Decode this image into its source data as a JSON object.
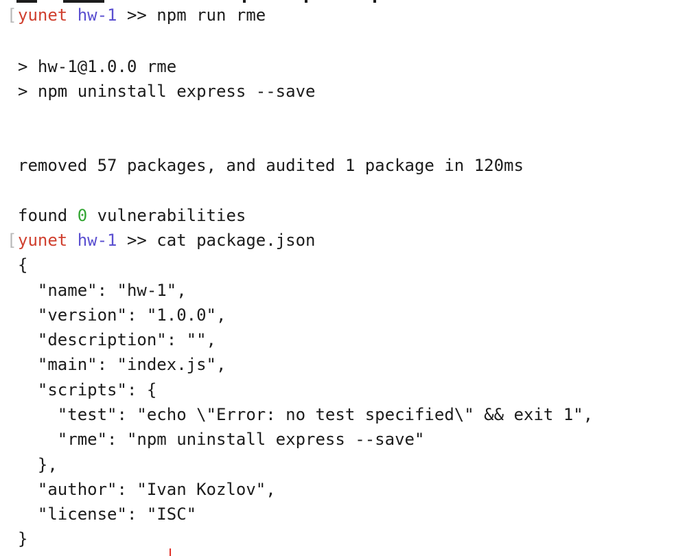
{
  "terminal": {
    "prompt1": {
      "user": "yunet",
      "dir": "hw-1",
      "sep": " >> ",
      "command": "npm run rme"
    },
    "output": {
      "script_header": "> hw-1@1.0.0 rme",
      "script_command": "> npm uninstall express --save",
      "removed": "removed 57 packages, and audited 1 package in 120ms",
      "found_prefix": "found ",
      "found_count": "0",
      "found_suffix": " vulnerabilities"
    },
    "prompt2": {
      "user": "yunet",
      "dir": "hw-1",
      "sep": " >> ",
      "command": "cat package.json"
    },
    "package_json": [
      "{",
      "  \"name\": \"hw-1\",",
      "  \"version\": \"1.0.0\",",
      "  \"description\": \"\",",
      "  \"main\": \"index.js\",",
      "  \"scripts\": {",
      "    \"test\": \"echo \\\"Error: no test specified\\\" && exit 1\",",
      "    \"rme\": \"npm uninstall express --save\"",
      "  },",
      "  \"author\": \"Ivan Kozlov\",",
      "  \"license\": \"ISC\"",
      "}"
    ],
    "bracket_glyph": "[",
    "colors": {
      "user": "#d0402f",
      "dir": "#5a4fd0",
      "zero": "#33a532",
      "text": "#1c1c1c",
      "cursor": "#e0322a"
    }
  }
}
